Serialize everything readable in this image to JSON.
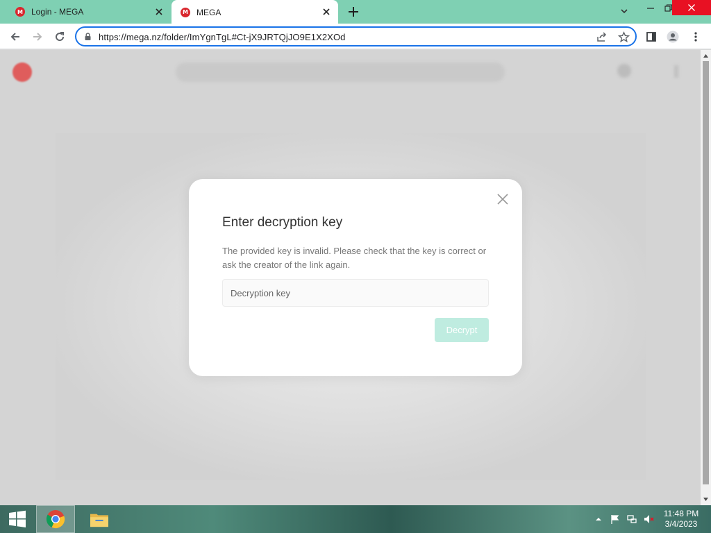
{
  "browser": {
    "tabs": [
      {
        "title": "Login - MEGA",
        "active": false
      },
      {
        "title": "MEGA",
        "active": true
      }
    ],
    "url": "https://mega.nz/folder/ImYgnTgL#Ct-jX9JRTQjJO9E1X2XOd"
  },
  "dialog": {
    "title": "Enter decryption key",
    "message": "The provided key is invalid. Please check that the key is correct or ask the creator of the link again.",
    "input_placeholder": "Decryption key",
    "input_value": "",
    "button_label": "Decrypt"
  },
  "taskbar": {
    "time": "11:48 PM",
    "date": "3/4/2023",
    "apps": [
      "chrome-icon",
      "file-explorer-icon"
    ]
  },
  "colors": {
    "tabstrip": "#7fd0b3",
    "mega_red": "#d9272e",
    "decrypt_button_disabled": "#bfece0",
    "omnibox_focus": "#1a73e8"
  }
}
